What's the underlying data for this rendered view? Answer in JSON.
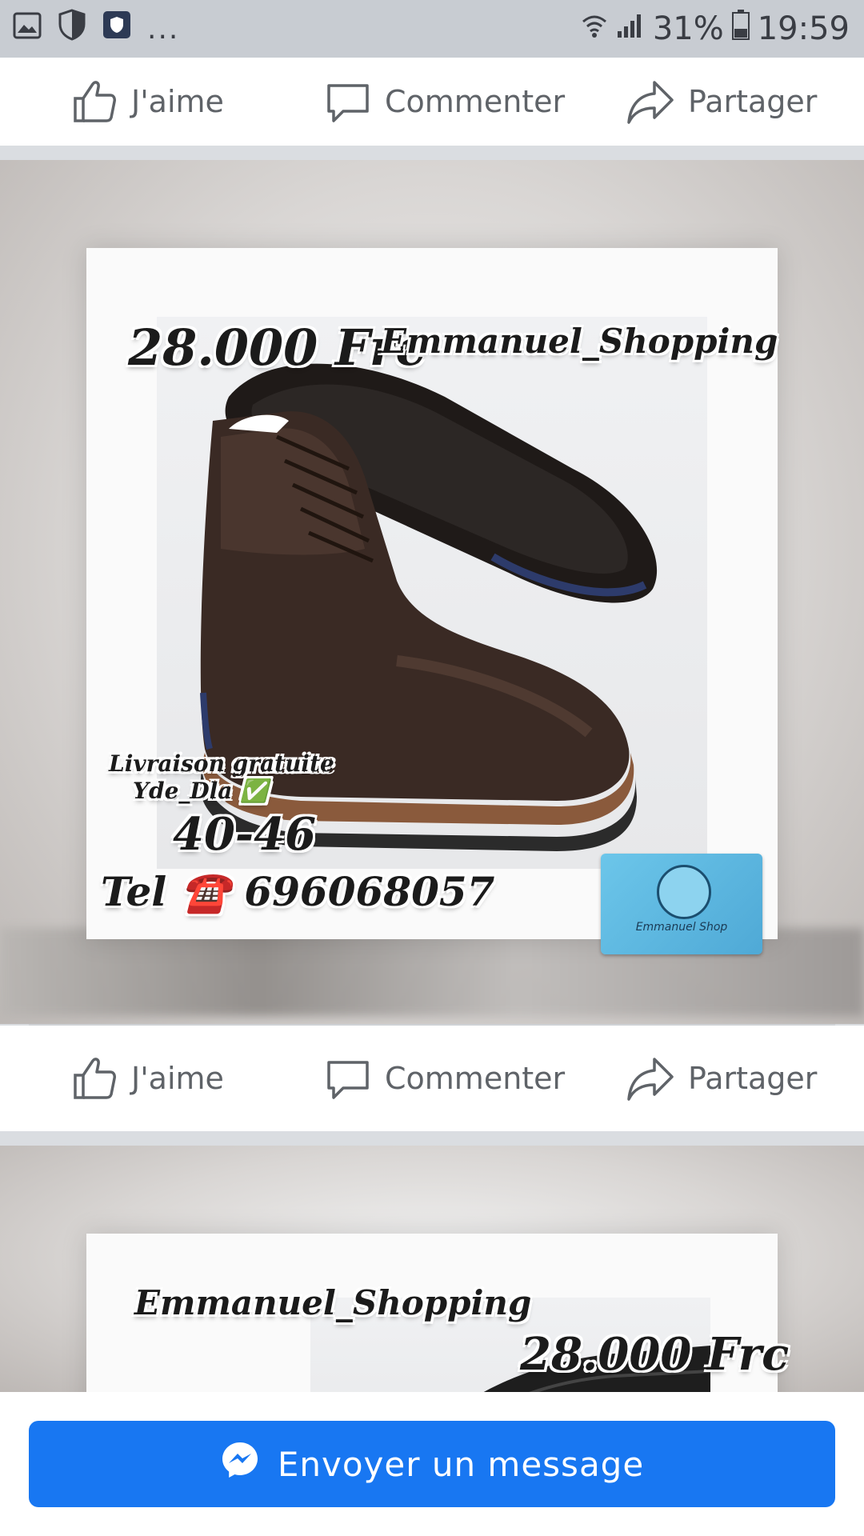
{
  "status_bar": {
    "dots": "...",
    "battery": "31%",
    "time": "19:59"
  },
  "actions": {
    "like": "J'aime",
    "comment": "Commenter",
    "share": "Partager"
  },
  "post1": {
    "price": "28.000 Frc",
    "shop": "Emmanuel_Shopping",
    "delivery_line1": "Livraison gratuite",
    "delivery_line2": "Yde_Dla ✅",
    "sizes": "40-46",
    "tel": "Tel ☎️ 696068057",
    "card_brand": "Emmanuel Shop"
  },
  "post2": {
    "shop": "Emmanuel_Shopping",
    "price": "28.000 Frc"
  },
  "bottom": {
    "message_button": "Envoyer un message"
  },
  "colors": {
    "accent": "#1877f2",
    "action_text": "#5f6368"
  }
}
